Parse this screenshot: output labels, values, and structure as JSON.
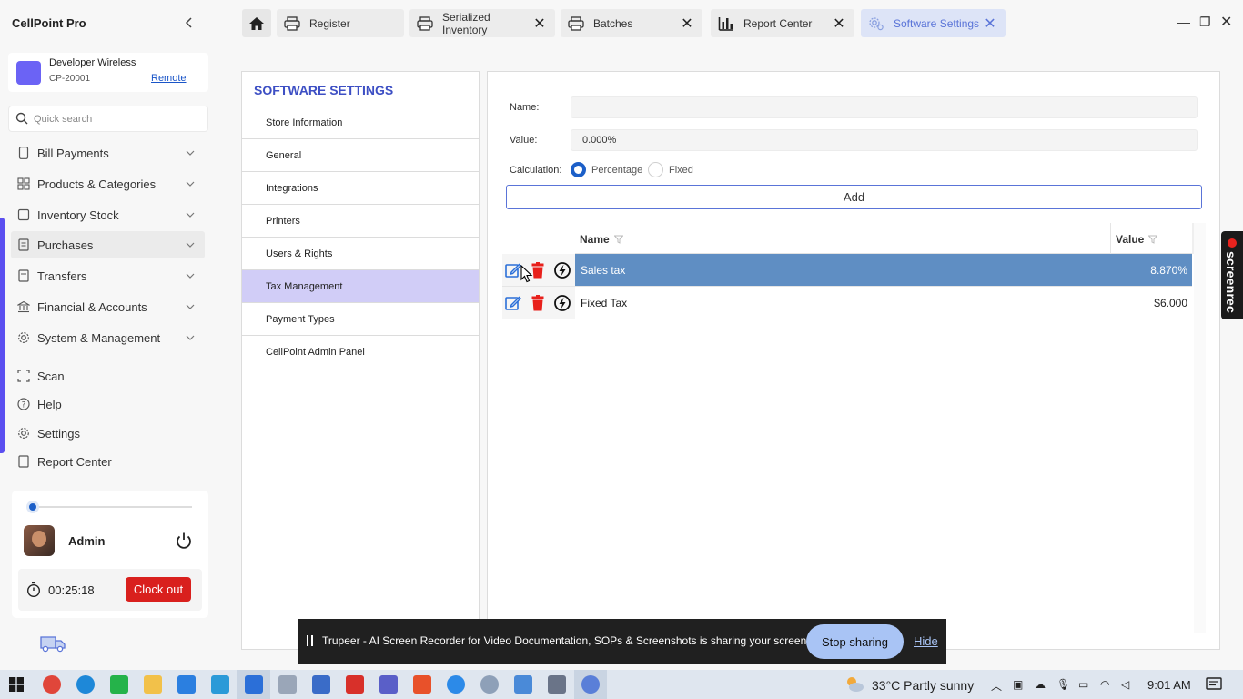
{
  "app": {
    "title": "CellPoint Pro"
  },
  "store": {
    "name": "Developer Wireless",
    "id": "CP-20001",
    "remote_label": "Remote"
  },
  "search": {
    "placeholder": "Quick search"
  },
  "nav": {
    "items": [
      {
        "label": "Bill Payments",
        "icon": "phone-icon",
        "has_chevron": true
      },
      {
        "label": "Products & Categories",
        "icon": "grid-icon",
        "has_chevron": true
      },
      {
        "label": "Inventory Stock",
        "icon": "box-icon",
        "has_chevron": true
      },
      {
        "label": "Purchases",
        "icon": "document-icon",
        "has_chevron": true,
        "active": true
      },
      {
        "label": "Transfers",
        "icon": "transfer-icon",
        "has_chevron": true
      },
      {
        "label": "Financial & Accounts",
        "icon": "bank-icon",
        "has_chevron": true
      },
      {
        "label": "System & Management",
        "icon": "gear-icon",
        "has_chevron": true
      },
      {
        "label": "Scan",
        "icon": "scan-icon"
      },
      {
        "label": "Help",
        "icon": "help-icon"
      },
      {
        "label": "Settings",
        "icon": "gear-icon"
      },
      {
        "label": "Report Center",
        "icon": "report-icon"
      }
    ]
  },
  "user": {
    "name": "Admin",
    "timer": "00:25:18",
    "clock_out_label": "Clock out"
  },
  "tabs": [
    {
      "label": "Register",
      "icon": "printer-icon",
      "closable": false
    },
    {
      "label": "Serialized Inventory",
      "icon": "printer-icon",
      "closable": true
    },
    {
      "label": "Batches",
      "icon": "printer-icon",
      "closable": true
    },
    {
      "label": "Report Center",
      "icon": "chart-icon",
      "closable": true
    },
    {
      "label": "Software Settings",
      "icon": "settings-icon",
      "closable": true,
      "active": true
    }
  ],
  "settings": {
    "title": "SOFTWARE SETTINGS",
    "items": [
      "Store Information",
      "General",
      "Integrations",
      "Printers",
      "Users & Rights",
      "Tax Management",
      "Payment Types",
      "CellPoint Admin Panel"
    ],
    "selected_index": 5
  },
  "tax_form": {
    "name_label": "Name:",
    "name_value": "",
    "value_label": "Value:",
    "value_value": "0.000%",
    "calculation_label": "Calculation:",
    "options": [
      "Percentage",
      "Fixed"
    ],
    "selected_option": "Percentage",
    "add_label": "Add"
  },
  "tax_table": {
    "columns": [
      "Name",
      "Value"
    ],
    "rows": [
      {
        "name": "Sales tax",
        "value": "8.870%",
        "selected": true
      },
      {
        "name": "Fixed Tax",
        "value": "$6.000",
        "selected": false
      }
    ]
  },
  "screenrec": {
    "label": "screenrec"
  },
  "sharebar": {
    "message": "Trupeer - AI Screen Recorder for Video Documentation, SOPs & Screenshots is sharing your screen.",
    "stop_label": "Stop sharing",
    "hide_label": "Hide"
  },
  "taskbar": {
    "weather": "33°C  Partly sunny",
    "time": "9:01 AM"
  },
  "colors": {
    "accent": "#5b4ff0",
    "selected_row": "#5f8ec3",
    "settings_title": "#3d4fc4",
    "clock_out": "#d9201d",
    "delete_icon": "#e8201b",
    "edit_icon": "#2b6fd8"
  }
}
